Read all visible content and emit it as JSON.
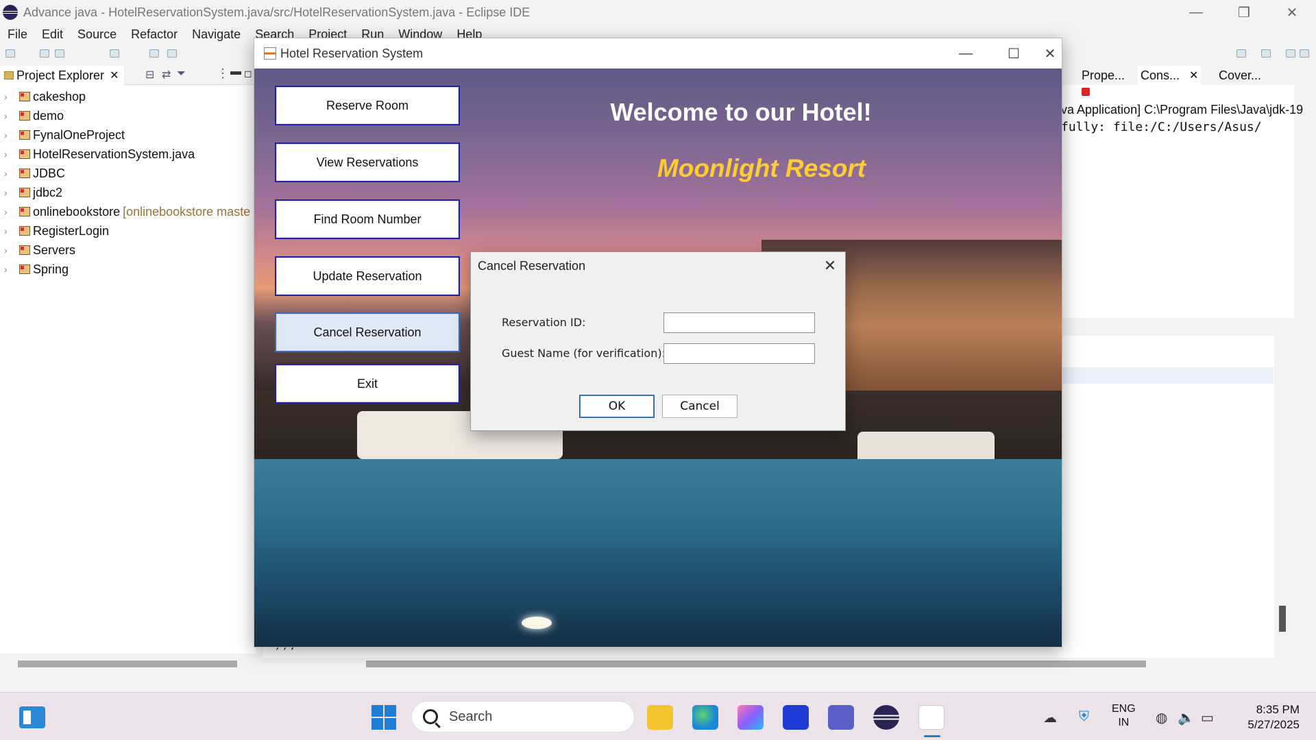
{
  "eclipse": {
    "title": "Advance java - HotelReservationSystem.java/src/HotelReservationSystem.java - Eclipse IDE",
    "menu": [
      "File",
      "Edit",
      "Source",
      "Refactor",
      "Navigate",
      "Search",
      "Project",
      "Run",
      "Window",
      "Help"
    ],
    "project_explorer": {
      "tab_label": "Project Explorer",
      "items": [
        {
          "label": "cakeshop",
          "decoration": ""
        },
        {
          "label": "demo",
          "decoration": ""
        },
        {
          "label": "FynalOneProject",
          "decoration": ""
        },
        {
          "label": "HotelReservationSystem.java",
          "decoration": ""
        },
        {
          "label": "JDBC",
          "decoration": ""
        },
        {
          "label": "jdbc2",
          "decoration": ""
        },
        {
          "label": "onlinebookstore",
          "decoration": "[onlinebookstore maste"
        },
        {
          "label": "RegisterLogin",
          "decoration": ""
        },
        {
          "label": "Servers",
          "decoration": ""
        },
        {
          "label": "Spring",
          "decoration": ""
        }
      ]
    },
    "right_tabs": [
      "Prope...",
      "Cons...",
      "Cover..."
    ],
    "console_line1": "va Application] C:\\Program Files\\Java\\jdk-19",
    "console_line2": "fully: file:/C:/Users/Asus/",
    "editor_fragment": "));"
  },
  "hotel_window": {
    "title": "Hotel Reservation System",
    "welcome": "Welcome to our Hotel!",
    "resort_name": "Moonlight Resort",
    "buttons": [
      "Reserve Room",
      "View Reservations",
      "Find Room Number",
      "Update Reservation",
      "Cancel Reservation",
      "Exit"
    ]
  },
  "dialog": {
    "title": "Cancel Reservation",
    "reservation_id_label": "Reservation ID:",
    "reservation_id_value": "",
    "guest_name_label": "Guest Name (for verification):",
    "guest_name_value": "",
    "ok_label": "OK",
    "cancel_label": "Cancel"
  },
  "taskbar": {
    "search_placeholder": "Search",
    "lang_line1": "ENG",
    "lang_line2": "IN",
    "time": "8:35 PM",
    "date": "5/27/2025"
  },
  "colors": {
    "accent": "#ffcc33",
    "button_border": "#2222a0"
  }
}
